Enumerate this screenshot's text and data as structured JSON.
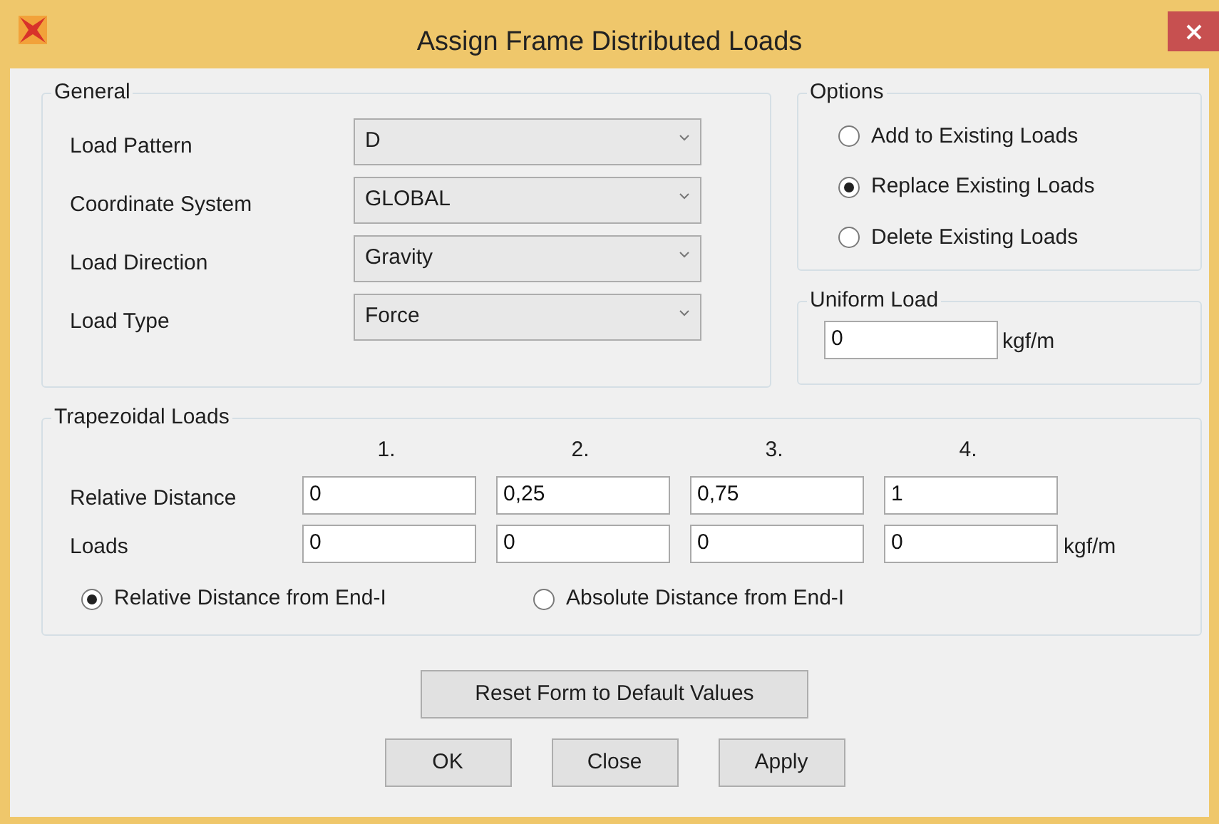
{
  "window": {
    "title": "Assign Frame Distributed Loads"
  },
  "general": {
    "title": "General",
    "fields": [
      {
        "label": "Load Pattern",
        "value": "D"
      },
      {
        "label": "Coordinate System",
        "value": "GLOBAL"
      },
      {
        "label": "Load Direction",
        "value": "Gravity"
      },
      {
        "label": "Load Type",
        "value": "Force"
      }
    ]
  },
  "options": {
    "title": "Options",
    "choices": [
      {
        "label": "Add to Existing Loads",
        "selected": false
      },
      {
        "label": "Replace Existing Loads",
        "selected": true
      },
      {
        "label": "Delete Existing Loads",
        "selected": false
      }
    ]
  },
  "uniform_load": {
    "title": "Uniform Load",
    "value": "0",
    "unit": "kgf/m"
  },
  "trapezoidal": {
    "title": "Trapezoidal Loads",
    "columns": [
      "1.",
      "2.",
      "3.",
      "4."
    ],
    "rows": [
      {
        "label": "Relative Distance",
        "values": [
          "0",
          "0,25",
          "0,75",
          "1"
        ]
      },
      {
        "label": "Loads",
        "values": [
          "0",
          "0",
          "0",
          "0"
        ],
        "unit": "kgf/m"
      }
    ],
    "choices": [
      {
        "label": "Relative Distance from End-I",
        "selected": true
      },
      {
        "label": "Absolute Distance from End-I",
        "selected": false
      }
    ]
  },
  "reset_button": "Reset Form to Default Values",
  "buttons": [
    "OK",
    "Close",
    "Apply"
  ]
}
